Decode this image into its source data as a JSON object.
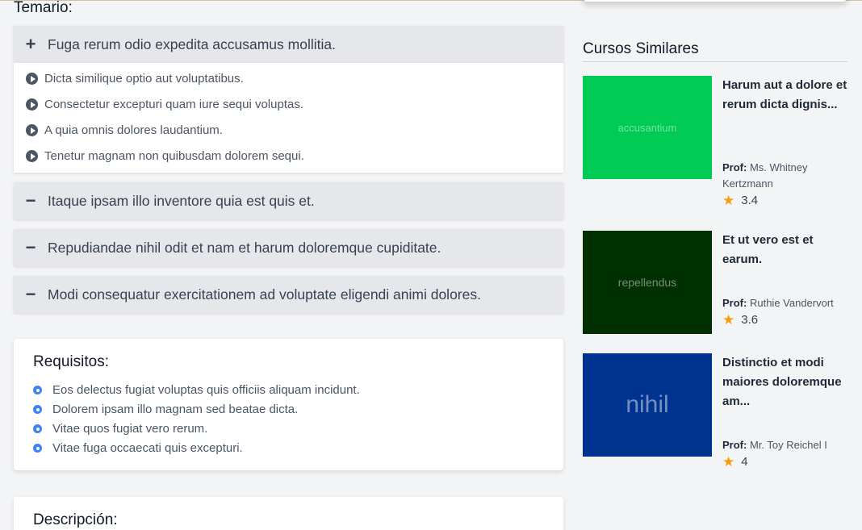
{
  "temario": {
    "title": "Temario:",
    "sections": [
      {
        "icon": "+",
        "title": "Fuga rerum odio expedita accusamus mollitia."
      },
      {
        "icon": "−",
        "title": "Itaque ipsam illo inventore quia est quis et."
      },
      {
        "icon": "−",
        "title": "Repudiandae nihil odit et nam et harum doloremque cupiditate."
      },
      {
        "icon": "−",
        "title": "Modi consequatur exercitationem ad voluptate eligendi animi dolores."
      }
    ],
    "lessons": [
      "Dicta similique optio aut voluptatibus.",
      "Consectetur excepturi quam iure sequi voluptas.",
      "A quia omnis dolores laudantium.",
      "Tenetur magnam non quibusdam dolorem sequi."
    ]
  },
  "requisitos": {
    "title": "Requisitos:",
    "items": [
      "Eos delectus fugiat voluptas quis officiis aliquam incidunt.",
      "Dolorem ipsam illo magnam sed beatae dicta.",
      "Vitae quos fugiat vero rerum.",
      "Vitae fuga occaecati quis excepturi."
    ]
  },
  "descripcion": {
    "title": "Descripción:"
  },
  "sidebar": {
    "title": "Cursos Similares",
    "prof_label": "Prof:",
    "courses": [
      {
        "thumb_text": "accusantium",
        "thumb_color": "#00cc55",
        "title": "Harum aut a dolore et rerum dicta dignis...",
        "prof": "Ms. Whitney Kertzmann",
        "rating": "3.4"
      },
      {
        "thumb_text": "repellendus",
        "thumb_color": "#002f00",
        "title": "Et ut vero est et earum.",
        "prof": "Ruthie Vandervort",
        "rating": "3.6"
      },
      {
        "thumb_text": "nihil",
        "thumb_color": "#00338f",
        "title": "Distinctio et modi maiores doloremque am...",
        "prof": "Mr. Toy Reichel I",
        "rating": "4"
      }
    ]
  },
  "colors": {
    "accent": "#3b82f6",
    "star": "#f59e0b",
    "section_bg": "#e5e7eb"
  }
}
